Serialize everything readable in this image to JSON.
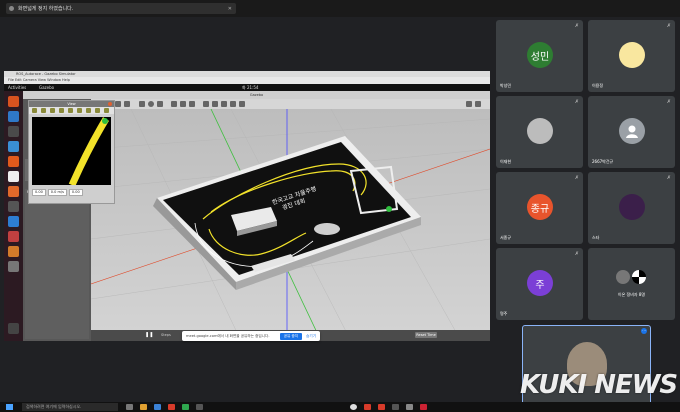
{
  "notification": {
    "text": "화면넓게 정지 하였습니다.",
    "close": "✕"
  },
  "screen_share": {
    "window_title": "ROS_Autorace - Gazebo Simulator",
    "menu": "File  Edit  Camera  View  Window  Help",
    "activities": "Activities",
    "app_name": "Gazebo",
    "clock": "화 21:54",
    "gazebo_title": "Gazebo",
    "image_window_title": "View",
    "properties_label": "Property",
    "coords": [
      "0.00",
      "0.0 m/s",
      "0.00"
    ],
    "track_sign_text": [
      "한국고교 자율주행",
      "경진 대회"
    ],
    "pause_glyph": "❚❚",
    "realtime_label": "Steps",
    "reset_label": "Reset Time"
  },
  "share_bar": {
    "message": "meet.google.com에서 내 화면을 공유하는 중입니다.",
    "stop_label": "공유 중지",
    "hide_label": "숨기기"
  },
  "participants": [
    {
      "initials": "성민",
      "name": "박성민",
      "color": "#2e7d32",
      "muted": true
    },
    {
      "initials": "",
      "name": "이용정",
      "color": "#f9e79f",
      "muted": true
    },
    {
      "initials": "",
      "name": "이재현",
      "color": "#bcbcbc",
      "muted": true
    },
    {
      "initials": "",
      "name": "2667박건규",
      "color": "#9aa0a6",
      "muted": true
    },
    {
      "initials": "종규",
      "name": "서종규",
      "color": "#e8542c",
      "muted": true
    },
    {
      "initials": "",
      "name": "스타",
      "color": "#3b1f4a",
      "muted": true
    },
    {
      "initials": "주",
      "name": "명주",
      "color": "#7b3fd6",
      "muted": true
    },
    {
      "initials": "",
      "name": "이온 정비자 8명",
      "color": "#555",
      "muted": false
    }
  ],
  "self_tile": {
    "more": "⋯"
  },
  "watermark": "KUKI NEWS",
  "taskbar": {
    "search_placeholder": "검색하려면 여기에 입력하십시오."
  },
  "colors": {
    "dock": "#2c1a22",
    "track_line": "#f2e22a",
    "stop_button": "#1a73e8"
  }
}
